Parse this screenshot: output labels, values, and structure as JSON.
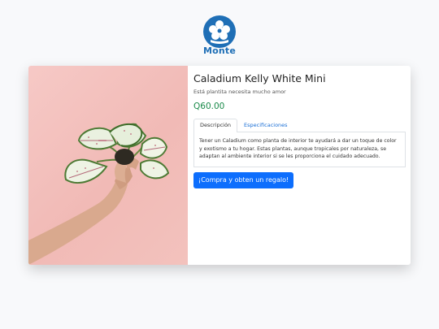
{
  "brand": {
    "name": "Monte",
    "accent": "#1f6fb6"
  },
  "product": {
    "title": "Caladium Kelly White Mini",
    "subtitle": "Está plantita necesita mucho amor",
    "price": "Q60.00",
    "image_icon": "caladium-plant-photo"
  },
  "tabs": [
    {
      "label": "Descripción",
      "active": true
    },
    {
      "label": "Especificaciones",
      "active": false
    }
  ],
  "description": "Tener un Caladium como planta de interior te ayudará a dar un toque de color y exotismo a tu hogar. Estas plantas, aunque tropicales por naturaleza, se adaptan al ambiente interior si se les proporciona el cuidado adecuado.",
  "cta": {
    "label": "¡Compra y obten un regalo!",
    "color": "#0d6efd"
  },
  "colors": {
    "price": "#1a8a4a",
    "photo_bg": "#f3c3bf"
  }
}
